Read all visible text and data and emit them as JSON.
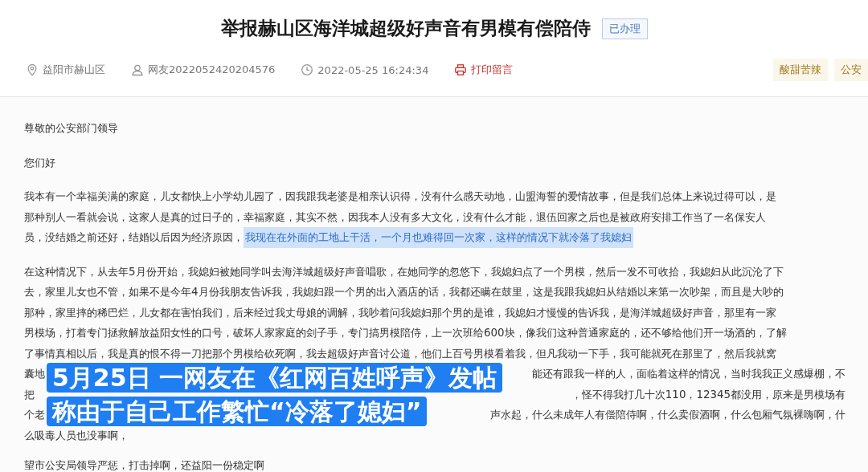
{
  "header": {
    "title": "举报赫山区海洋城超级好声音有男模有偿陪侍",
    "status_badge": "已办理",
    "meta": [
      {
        "kind": "location",
        "text": "益阳市赫山区"
      },
      {
        "kind": "user",
        "text": "网友2022052420204576"
      },
      {
        "kind": "time",
        "text": "2022-05-25 16:24:34"
      },
      {
        "kind": "print",
        "text": "打印留言"
      }
    ],
    "tags": [
      "酸甜苦辣",
      "公安"
    ]
  },
  "letter": {
    "paragraphs": [
      {
        "lines": [
          {
            "kind": "text",
            "segments": [
              {
                "text": "尊敬的公安部门领导",
                "highlighted": false
              }
            ]
          }
        ]
      },
      {
        "lines": [
          {
            "kind": "text",
            "segments": [
              {
                "text": "您们好",
                "highlighted": false
              }
            ]
          }
        ]
      },
      {
        "lines": [
          {
            "kind": "text",
            "segments": [
              {
                "text": "我本有一个幸福美满的家庭，儿女都快上小学幼儿园了，因我跟我老婆是相亲认识得，没有什么感天动地，山盟海誓的爱情故事，但是我们总体上来说过得可以，是",
                "highlighted": false
              }
            ]
          },
          {
            "kind": "text",
            "segments": [
              {
                "text": "那种别人一看就会说，这家人是真的过日子的，幸福家庭，其实不然，因我本人没有多大文化，没有什么才能，退伍回家之后也是被政府安排工作当了一名保安人",
                "highlighted": false
              }
            ]
          },
          {
            "kind": "text",
            "segments": [
              {
                "text": "员，没结婚之前还好，结婚以后因为经济原因，",
                "highlighted": false
              },
              {
                "text": "我现在在外面的工地上干活，一个月也难得回一次家，这样的情况下就冷落了我媳妇",
                "highlighted": true
              }
            ]
          }
        ]
      },
      {
        "lines": [
          {
            "kind": "text",
            "segments": [
              {
                "text": "在这种情况下，从去年5月份开始，我媳妇被她同学叫去海洋城超级好声音唱歌，在她同学的忽悠下，我媳妇点了一个男模，然后一发不可收拾，我媳妇从此沉沦了下",
                "highlighted": false
              }
            ]
          },
          {
            "kind": "text",
            "segments": [
              {
                "text": "去，家里儿女也不管，如果不是今年4月份我朋友告诉我，我媳妇跟一个男的出入酒店的话，我都还瞒在鼓里，这是我跟我媳妇从结婚以来第一次吵架，而且是大吵的",
                "highlighted": false
              }
            ]
          },
          {
            "kind": "text",
            "segments": [
              {
                "text": "那种，家里摔的稀巴烂，儿女都在害怕我们，后来经过我丈母娘的调解，我吵着问我媳妇那个男的是谁，我媳妇才慢慢的告诉我，是海洋城超级好声音，那里有一家",
                "highlighted": false
              }
            ]
          },
          {
            "kind": "text",
            "segments": [
              {
                "text": "男模场，打着专门拯救解放益阳女性的口号，破坏人家家庭的刽子手，专门搞男模陪侍，上一次班给600块，像我们这种普通家庭的，还不够给他们开一场酒的，了解",
                "highlighted": false
              }
            ]
          },
          {
            "kind": "text",
            "segments": [
              {
                "text": "了事情真相以后，我是真的恨不得一刀把那个男模给砍死啊，我去超级好声音讨公道，他们上百号男模看着我，但凡我动一下手，我可能就死在那里了，然后我就窝",
                "highlighted": false
              }
            ]
          },
          {
            "kind": "split",
            "segments": [
              {
                "text": "囊地",
                "highlighted": false
              },
              {
                "text": "能还有跟我一样的人，面临着这样的情况，当时我我正义感爆棚，不",
                "highlighted": false
              }
            ]
          },
          {
            "kind": "split",
            "segments": [
              {
                "text": "把",
                "highlighted": false
              },
              {
                "text": "，怪不得我打几十次110，12345都没用，原来是男模场有",
                "highlighted": false
              }
            ]
          },
          {
            "kind": "split",
            "segments": [
              {
                "text": "个老",
                "highlighted": false
              },
              {
                "text": "声水起，什么未成年人有偿陪侍啊，什么卖假酒啊，什么包厢气氛裸嗨啊，什",
                "highlighted": false
              }
            ]
          },
          {
            "kind": "text",
            "segments": [
              {
                "text": "么吸毒人员也没事啊，",
                "highlighted": false
              }
            ]
          }
        ]
      },
      {
        "lines": [
          {
            "kind": "text",
            "segments": [
              {
                "text": "望市公安局领导严惩，打击掉啊，还益阳一份稳定啊",
                "highlighted": false
              }
            ]
          }
        ]
      }
    ]
  },
  "captions": [
    "5月25日 一网友在《红网百姓呼声》发帖",
    "称由于自己工作繁忙“冷落了媳妇”"
  ]
}
